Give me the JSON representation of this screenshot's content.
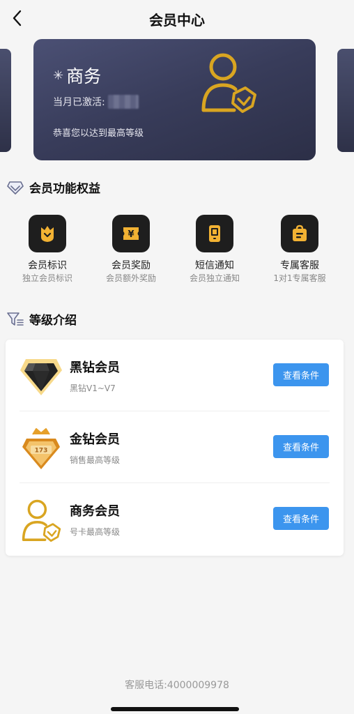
{
  "header": {
    "title": "会员中心",
    "back_icon": "chevron-left-icon"
  },
  "card": {
    "title": "商务",
    "sparkle_icon": "sparkle-icon",
    "activated_label": "当月已激活:",
    "congrats": "恭喜您以达到最高等级",
    "badge_icon": "business-member-icon"
  },
  "benefits_section": {
    "title": "会员功能权益",
    "icon": "diamond-outline-icon",
    "items": [
      {
        "name": "会员标识",
        "desc": "独立会员标识",
        "icon": "member-badge-icon"
      },
      {
        "name": "会员奖励",
        "desc": "会员额外奖励",
        "icon": "yuan-ticket-icon"
      },
      {
        "name": "短信通知",
        "desc": "会员独立通知",
        "icon": "phone-sms-icon"
      },
      {
        "name": "专属客服",
        "desc": "1对1专属客服",
        "icon": "service-bag-icon"
      }
    ]
  },
  "levels_section": {
    "title": "等级介绍",
    "icon": "funnel-icon",
    "items": [
      {
        "name": "黑钻会员",
        "desc": "黑钻V1~V7",
        "button": "查看条件",
        "icon": "black-diamond-icon"
      },
      {
        "name": "金钻会员",
        "desc": "销售最高等级",
        "button": "查看条件",
        "icon": "gold-diamond-icon",
        "badge_text": "173"
      },
      {
        "name": "商务会员",
        "desc": "号卡最高等级",
        "button": "查看条件",
        "icon": "business-member-icon"
      }
    ]
  },
  "footer": {
    "phone": "客服电话:4000009978"
  },
  "colors": {
    "accent_blue": "#3c95ee",
    "gold": "#d9a521",
    "card_dark": "#383c5a"
  }
}
